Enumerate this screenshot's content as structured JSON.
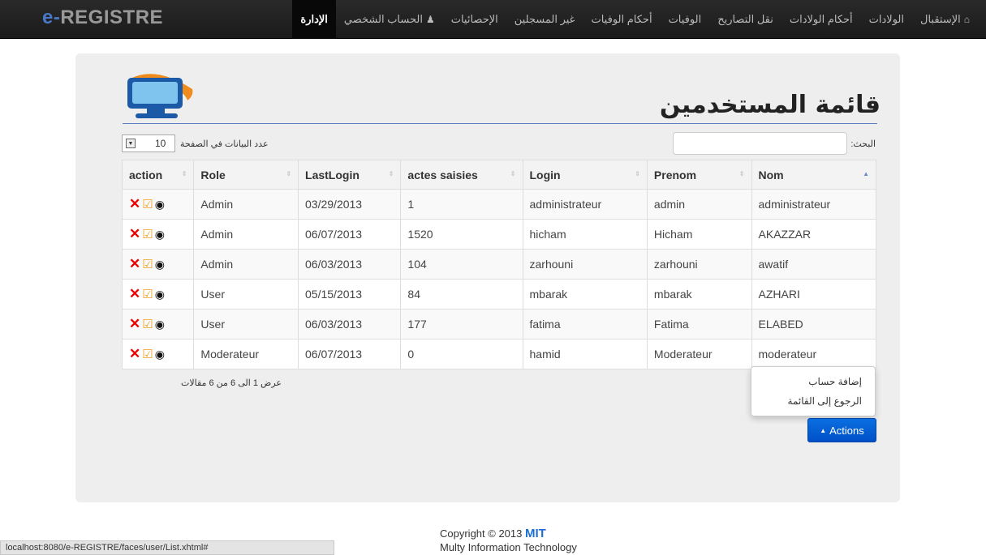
{
  "brand": {
    "prefix": "e-",
    "name": "REGISTRE"
  },
  "nav": {
    "items": [
      {
        "label": "الإستقبال",
        "icon": "home-icon",
        "glyph": "⌂"
      },
      {
        "label": "الولادات"
      },
      {
        "label": "أحكام الولادات"
      },
      {
        "label": "نقل التصاريح"
      },
      {
        "label": "الوفيات"
      },
      {
        "label": "أحكام الوفيات"
      },
      {
        "label": "غير المسجلين"
      },
      {
        "label": "الإحصائيات"
      },
      {
        "label": "الحساب الشخصي",
        "icon": "user-icon",
        "glyph": "♟"
      },
      {
        "label": "الإدارة",
        "active": true
      }
    ]
  },
  "page": {
    "title": "قائمة المستخدمين"
  },
  "length": {
    "label": "عدد البيانات في الصفحة",
    "value": "10"
  },
  "search": {
    "label": "البحث:",
    "placeholder": ""
  },
  "table": {
    "columns": [
      "action",
      "Role",
      "LastLogin",
      "actes saisies",
      "Login",
      "Prenom",
      "Nom"
    ],
    "rows": [
      [
        "",
        "Admin",
        "03/29/2013",
        "1",
        "administrateur",
        "admin",
        "administrateur"
      ],
      [
        "",
        "Admin",
        "06/07/2013",
        "1520",
        "hicham",
        "Hicham",
        "AKAZZAR"
      ],
      [
        "",
        "Admin",
        "06/03/2013",
        "104",
        "zarhouni",
        "zarhouni",
        "awatif"
      ],
      [
        "",
        "User",
        "05/15/2013",
        "84",
        "mbarak",
        "mbarak",
        "AZHARI"
      ],
      [
        "",
        "User",
        "06/03/2013",
        "177",
        "fatima",
        "Fatima",
        "ELABED"
      ],
      [
        "",
        "Moderateur",
        "06/07/2013",
        "0",
        "hamid",
        "Moderateur",
        "moderateur"
      ]
    ]
  },
  "info": "عرض 1 الى 6 من 6 مقالات",
  "menu": {
    "items": [
      "إضافة حساب",
      "الرجوع إلى القائمة"
    ]
  },
  "actions_button": "Actions",
  "footer": {
    "copyright": "Copyright © 2013",
    "company": "MIT",
    "full_name": "Multy Information Technology"
  },
  "statusbar": "localhost:8080/e-REGISTRE/faces/user/List.xhtml#",
  "colors": {
    "accent": "#0a6fe0",
    "navbar": "#1f1f1f",
    "panel": "#eeeeee"
  }
}
